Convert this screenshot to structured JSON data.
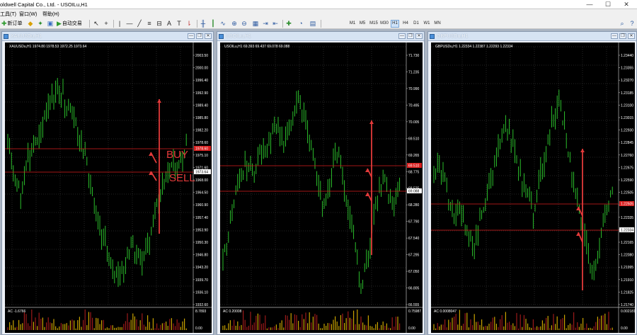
{
  "app": {
    "title": "oldwell Capital Co., Ltd. - USOILu,H1",
    "minimize": "—",
    "maximize": "☐",
    "close": "✕"
  },
  "menu": [
    "工具(T)",
    "窗口(W)",
    "帮助(H)"
  ],
  "toolbar": {
    "new_order_label": "新订单",
    "auto_trade_label": "自动交易",
    "timeframes": [
      "M1",
      "M5",
      "M15",
      "M30",
      "H1",
      "H4",
      "D1",
      "W1",
      "MN"
    ],
    "active_timeframe": "H1"
  },
  "charts": [
    {
      "window_title": "XAUUSDu,H1",
      "header": "XAUUSDu,H1  1974.80 1978.53 1972.25 1973.64",
      "price_ticks": [
        "2003.50",
        "2000.00",
        "1996.40",
        "1992.90",
        "1989.40",
        "1985.80",
        "1982.20",
        "1978.60",
        "1975.10",
        "1971.60",
        "1968.00",
        "1964.50",
        "1960.90",
        "1957.40",
        "1953.90",
        "1950.30",
        "1946.80",
        "1943.20",
        "1939.70",
        "1936.10",
        "1932.60"
      ],
      "current_price": "1973.64",
      "marked_price": "1978.60",
      "indicator_label": "AC -1.6766",
      "indicator_ticks": [
        "8.7893",
        "0.00"
      ],
      "buy_label": "BUY",
      "sell_label": "SELL"
    },
    {
      "window_title": "USOILu,H1",
      "header": "USOILu,H1  69.393 69.437 69.078 69.088",
      "price_ticks": [
        "71.730",
        "71.235",
        "70.990",
        "70.495",
        "70.005",
        "69.510",
        "69.265",
        "68.775",
        "68.525",
        "68.280",
        "67.790",
        "67.540",
        "67.295",
        "67.050",
        "66.805",
        "66.555"
      ],
      "current_price": "69.088",
      "marked_price": "69.510",
      "indicator_label": "AC 0.20008",
      "indicator_ticks": [
        "0.75987",
        "0.00"
      ]
    },
    {
      "window_title": "GBPUSDu,H1",
      "header": "GBPUSDu,H1  1.22334 1.22387 1.22293 1.22334",
      "price_ticks": [
        "1.23440",
        "1.23355",
        "1.23270",
        "1.23185",
        "1.23100",
        "1.23015",
        "1.22930",
        "1.22845",
        "1.22760",
        "1.22675",
        "1.22590",
        "1.22505",
        "1.22420",
        "1.22335",
        "1.22250",
        "1.22165",
        "1.22080",
        "1.21995",
        "1.21910",
        "1.21825",
        "1.21740"
      ],
      "current_price": "1.22334",
      "marked_price": "1.22505",
      "indicator_label": "AC 0.0008047",
      "indicator_ticks": [
        "0.0021813",
        "0.00"
      ]
    }
  ],
  "colors": {
    "bull": "#2fd32f",
    "bear": "#2fd32f",
    "grid": "#4a4a4a",
    "level": "#d91e1e",
    "arrow": "#e23a3a",
    "ind_pos": "#c8a200",
    "ind_neg": "#9b1a1a"
  },
  "icons": [
    "new-order-icon",
    "auto-trade-icon",
    "cursor-icon",
    "crosshair-icon",
    "line-icon",
    "zoom-in-icon",
    "zoom-out-icon",
    "grid-icon",
    "indicators-icon",
    "period-icon",
    "templates-icon",
    "search-icon",
    "help-icon"
  ]
}
